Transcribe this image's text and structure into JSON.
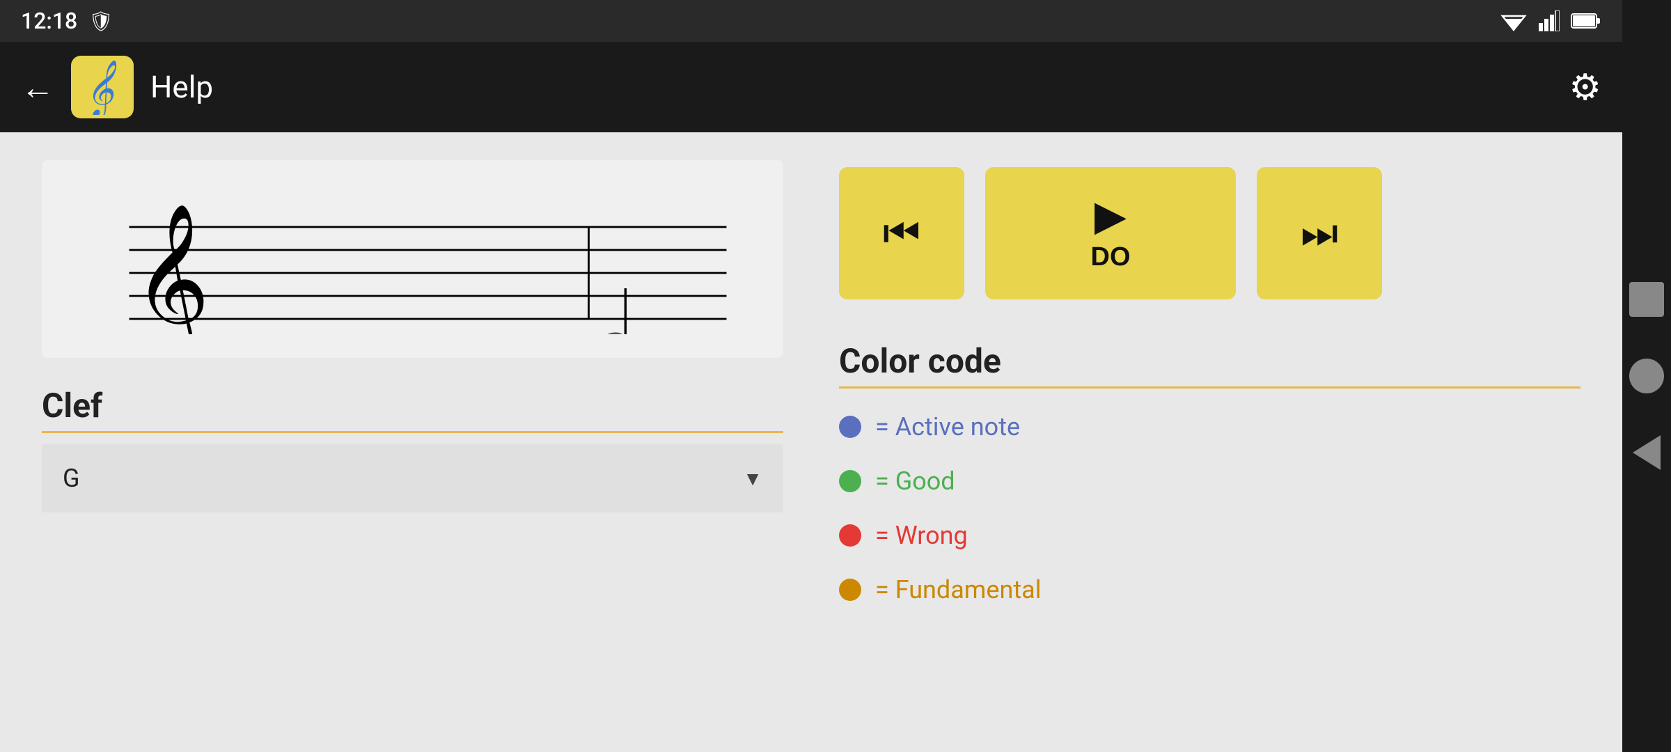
{
  "statusBar": {
    "time": "12:18",
    "shieldIcon": "🛡",
    "wifiIcon": "▼",
    "signalIcon": "◁",
    "batteryIcon": "🔋"
  },
  "appBar": {
    "backLabel": "←",
    "title": "Help",
    "settingsLabel": "⚙"
  },
  "transport": {
    "prevLabel": "⏮",
    "playLabel": "▶",
    "playNote": "DO",
    "nextLabel": "⏭"
  },
  "clef": {
    "sectionTitle": "Clef",
    "selectedValue": "G",
    "dropdownArrow": "▼"
  },
  "colorCode": {
    "sectionTitle": "Color code",
    "items": [
      {
        "color": "#5b6fbf",
        "label": "= Active note"
      },
      {
        "color": "#4caf50",
        "label": "= Good"
      },
      {
        "color": "#e53935",
        "label": "= Wrong"
      },
      {
        "color": "#cc8800",
        "label": "= Fundamental"
      }
    ]
  }
}
